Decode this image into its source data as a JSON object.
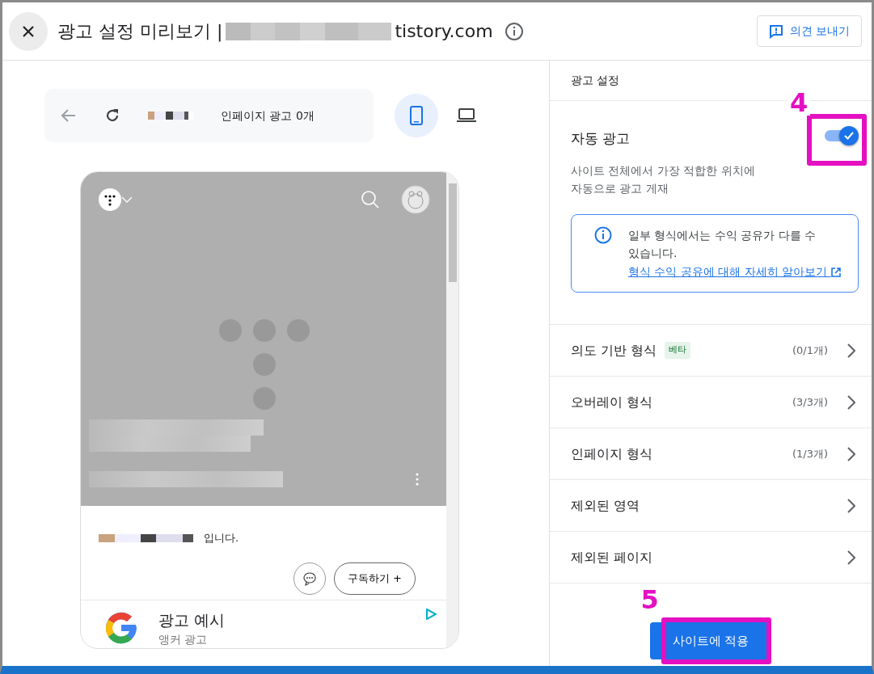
{
  "header": {
    "title": "광고 설정 미리보기 |",
    "title_suffix": "tistory.com",
    "feedback_button": "의견 보내기"
  },
  "toolbar": {
    "page_ad_count": "인페이지 광고 0개",
    "devices": [
      {
        "kind": "mobile",
        "selected": true
      },
      {
        "kind": "desktop",
        "selected": false
      }
    ]
  },
  "preview": {
    "post_text": "입니다.",
    "subscribe_button": "구독하기 +",
    "ad": {
      "title": "광고 예시",
      "subtitle": "앵커 광고"
    }
  },
  "settings": {
    "heading": "광고 설정",
    "auto_ads": {
      "label": "자동 광고",
      "on": true,
      "description": "사이트 전체에서 가장 적합한 위치에 자동으로 광고 게재",
      "notice": "일부 형식에서는 수익 공유가 다를 수 있습니다.",
      "link": "형식 수익 공유에 대해 자세히 알아보기"
    },
    "items": [
      {
        "label": "의도 기반 형식",
        "badge": "베타",
        "count": "(0/1개)"
      },
      {
        "label": "오버레이 형식",
        "count": "(3/3개)"
      },
      {
        "label": "인페이지 형식",
        "count": "(1/3개)"
      },
      {
        "label": "제외된 영역"
      },
      {
        "label": "제외된 페이지"
      }
    ],
    "apply_button": "사이트에 적용"
  },
  "annotations": {
    "toggle_number": "4",
    "apply_number": "5"
  }
}
